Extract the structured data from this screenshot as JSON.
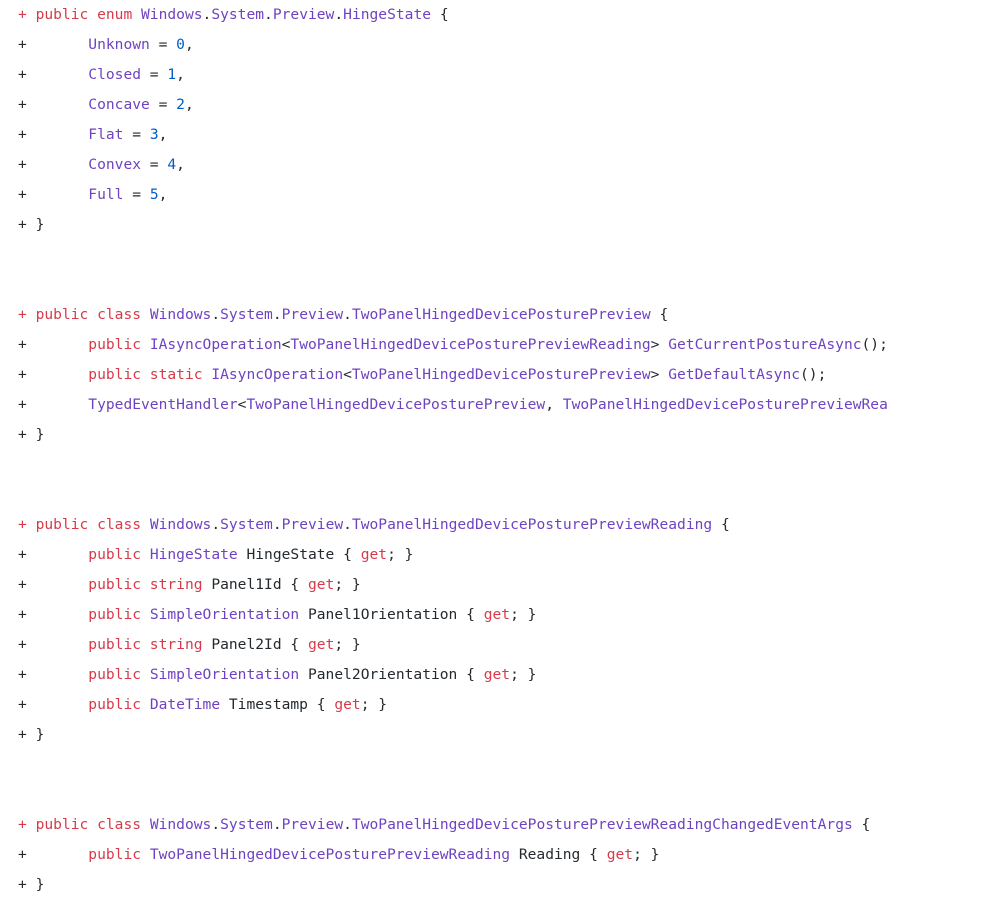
{
  "document": {
    "kind": "api-diff",
    "language": "csharp",
    "colors": {
      "background": "#ffffff",
      "keyword": "#d73a49",
      "type": "#6f42c1",
      "number": "#005cc5",
      "plain": "#24292e"
    }
  },
  "lines": [
    {
      "id": "line-1",
      "type": "addition",
      "tokens": [
        {
          "t": "+ ",
          "c": "kw"
        },
        {
          "t": "public enum ",
          "c": "kw"
        },
        {
          "t": "Windows",
          "c": "type"
        },
        {
          "t": ".",
          "c": "plain"
        },
        {
          "t": "System",
          "c": "type"
        },
        {
          "t": ".",
          "c": "plain"
        },
        {
          "t": "Preview",
          "c": "type"
        },
        {
          "t": ".",
          "c": "plain"
        },
        {
          "t": "HingeState",
          "c": "type"
        },
        {
          "t": " {",
          "c": "plain"
        }
      ]
    },
    {
      "id": "line-2",
      "type": "addition",
      "tokens": [
        {
          "t": "+ ",
          "c": "marker"
        },
        {
          "t": "      ",
          "c": "plain"
        },
        {
          "t": "Unknown",
          "c": "type"
        },
        {
          "t": " = ",
          "c": "plain"
        },
        {
          "t": "0",
          "c": "num"
        },
        {
          "t": ",",
          "c": "plain"
        }
      ]
    },
    {
      "id": "line-3",
      "type": "addition",
      "tokens": [
        {
          "t": "+ ",
          "c": "marker"
        },
        {
          "t": "      ",
          "c": "plain"
        },
        {
          "t": "Closed",
          "c": "type"
        },
        {
          "t": " = ",
          "c": "plain"
        },
        {
          "t": "1",
          "c": "num"
        },
        {
          "t": ",",
          "c": "plain"
        }
      ]
    },
    {
      "id": "line-4",
      "type": "addition",
      "tokens": [
        {
          "t": "+ ",
          "c": "marker"
        },
        {
          "t": "      ",
          "c": "plain"
        },
        {
          "t": "Concave",
          "c": "type"
        },
        {
          "t": " = ",
          "c": "plain"
        },
        {
          "t": "2",
          "c": "num"
        },
        {
          "t": ",",
          "c": "plain"
        }
      ]
    },
    {
      "id": "line-5",
      "type": "addition",
      "tokens": [
        {
          "t": "+ ",
          "c": "marker"
        },
        {
          "t": "      ",
          "c": "plain"
        },
        {
          "t": "Flat",
          "c": "type"
        },
        {
          "t": " = ",
          "c": "plain"
        },
        {
          "t": "3",
          "c": "num"
        },
        {
          "t": ",",
          "c": "plain"
        }
      ]
    },
    {
      "id": "line-6",
      "type": "addition",
      "tokens": [
        {
          "t": "+ ",
          "c": "marker"
        },
        {
          "t": "      ",
          "c": "plain"
        },
        {
          "t": "Convex",
          "c": "type"
        },
        {
          "t": " = ",
          "c": "plain"
        },
        {
          "t": "4",
          "c": "num"
        },
        {
          "t": ",",
          "c": "plain"
        }
      ]
    },
    {
      "id": "line-7",
      "type": "addition",
      "tokens": [
        {
          "t": "+ ",
          "c": "marker"
        },
        {
          "t": "      ",
          "c": "plain"
        },
        {
          "t": "Full",
          "c": "type"
        },
        {
          "t": " = ",
          "c": "plain"
        },
        {
          "t": "5",
          "c": "num"
        },
        {
          "t": ",",
          "c": "plain"
        }
      ]
    },
    {
      "id": "line-8",
      "type": "addition",
      "tokens": [
        {
          "t": "+ ",
          "c": "marker"
        },
        {
          "t": "}",
          "c": "plain"
        }
      ]
    },
    {
      "id": "line-9",
      "type": "blank",
      "tokens": []
    },
    {
      "id": "line-10",
      "type": "blank",
      "tokens": []
    },
    {
      "id": "line-11",
      "type": "addition",
      "tokens": [
        {
          "t": "+ ",
          "c": "kw"
        },
        {
          "t": "public class ",
          "c": "kw"
        },
        {
          "t": "Windows",
          "c": "type"
        },
        {
          "t": ".",
          "c": "plain"
        },
        {
          "t": "System",
          "c": "type"
        },
        {
          "t": ".",
          "c": "plain"
        },
        {
          "t": "Preview",
          "c": "type"
        },
        {
          "t": ".",
          "c": "plain"
        },
        {
          "t": "TwoPanelHingedDevicePosturePreview",
          "c": "type"
        },
        {
          "t": " {",
          "c": "plain"
        }
      ]
    },
    {
      "id": "line-12",
      "type": "addition",
      "tokens": [
        {
          "t": "+ ",
          "c": "marker"
        },
        {
          "t": "      ",
          "c": "plain"
        },
        {
          "t": "public ",
          "c": "kw"
        },
        {
          "t": "IAsyncOperation",
          "c": "type"
        },
        {
          "t": "<",
          "c": "plain"
        },
        {
          "t": "TwoPanelHingedDevicePosturePreviewReading",
          "c": "type"
        },
        {
          "t": "> ",
          "c": "plain"
        },
        {
          "t": "GetCurrentPostureAsync",
          "c": "type"
        },
        {
          "t": "();",
          "c": "plain"
        }
      ]
    },
    {
      "id": "line-13",
      "type": "addition",
      "tokens": [
        {
          "t": "+ ",
          "c": "marker"
        },
        {
          "t": "      ",
          "c": "plain"
        },
        {
          "t": "public static ",
          "c": "kw"
        },
        {
          "t": "IAsyncOperation",
          "c": "type"
        },
        {
          "t": "<",
          "c": "plain"
        },
        {
          "t": "TwoPanelHingedDevicePosturePreview",
          "c": "type"
        },
        {
          "t": "> ",
          "c": "plain"
        },
        {
          "t": "GetDefaultAsync",
          "c": "type"
        },
        {
          "t": "();",
          "c": "plain"
        }
      ]
    },
    {
      "id": "line-14",
      "type": "addition",
      "tokens": [
        {
          "t": "+ ",
          "c": "marker"
        },
        {
          "t": "      ",
          "c": "plain"
        },
        {
          "t": "TypedEventHandler",
          "c": "type"
        },
        {
          "t": "<",
          "c": "plain"
        },
        {
          "t": "TwoPanelHingedDevicePosturePreview",
          "c": "type"
        },
        {
          "t": ", ",
          "c": "plain"
        },
        {
          "t": "TwoPanelHingedDevicePosturePreviewRea",
          "c": "type"
        }
      ]
    },
    {
      "id": "line-15",
      "type": "addition",
      "tokens": [
        {
          "t": "+ ",
          "c": "marker"
        },
        {
          "t": "}",
          "c": "plain"
        }
      ]
    },
    {
      "id": "line-16",
      "type": "blank",
      "tokens": []
    },
    {
      "id": "line-17",
      "type": "blank",
      "tokens": []
    },
    {
      "id": "line-18",
      "type": "addition",
      "tokens": [
        {
          "t": "+ ",
          "c": "kw"
        },
        {
          "t": "public class ",
          "c": "kw"
        },
        {
          "t": "Windows",
          "c": "type"
        },
        {
          "t": ".",
          "c": "plain"
        },
        {
          "t": "System",
          "c": "type"
        },
        {
          "t": ".",
          "c": "plain"
        },
        {
          "t": "Preview",
          "c": "type"
        },
        {
          "t": ".",
          "c": "plain"
        },
        {
          "t": "TwoPanelHingedDevicePosturePreviewReading",
          "c": "type"
        },
        {
          "t": " {",
          "c": "plain"
        }
      ]
    },
    {
      "id": "line-19",
      "type": "addition",
      "tokens": [
        {
          "t": "+ ",
          "c": "marker"
        },
        {
          "t": "      ",
          "c": "plain"
        },
        {
          "t": "public ",
          "c": "kw"
        },
        {
          "t": "HingeState",
          "c": "type"
        },
        {
          "t": " HingeState { ",
          "c": "plain"
        },
        {
          "t": "get",
          "c": "kw"
        },
        {
          "t": "; }",
          "c": "plain"
        }
      ]
    },
    {
      "id": "line-20",
      "type": "addition",
      "tokens": [
        {
          "t": "+ ",
          "c": "marker"
        },
        {
          "t": "      ",
          "c": "plain"
        },
        {
          "t": "public string",
          "c": "kw"
        },
        {
          "t": " Panel1Id { ",
          "c": "plain"
        },
        {
          "t": "get",
          "c": "kw"
        },
        {
          "t": "; }",
          "c": "plain"
        }
      ]
    },
    {
      "id": "line-21",
      "type": "addition",
      "tokens": [
        {
          "t": "+ ",
          "c": "marker"
        },
        {
          "t": "      ",
          "c": "plain"
        },
        {
          "t": "public ",
          "c": "kw"
        },
        {
          "t": "SimpleOrientation",
          "c": "type"
        },
        {
          "t": " Panel1Orientation { ",
          "c": "plain"
        },
        {
          "t": "get",
          "c": "kw"
        },
        {
          "t": "; }",
          "c": "plain"
        }
      ]
    },
    {
      "id": "line-22",
      "type": "addition",
      "tokens": [
        {
          "t": "+ ",
          "c": "marker"
        },
        {
          "t": "      ",
          "c": "plain"
        },
        {
          "t": "public string",
          "c": "kw"
        },
        {
          "t": " Panel2Id { ",
          "c": "plain"
        },
        {
          "t": "get",
          "c": "kw"
        },
        {
          "t": "; }",
          "c": "plain"
        }
      ]
    },
    {
      "id": "line-23",
      "type": "addition",
      "tokens": [
        {
          "t": "+ ",
          "c": "marker"
        },
        {
          "t": "      ",
          "c": "plain"
        },
        {
          "t": "public ",
          "c": "kw"
        },
        {
          "t": "SimpleOrientation",
          "c": "type"
        },
        {
          "t": " Panel2Orientation { ",
          "c": "plain"
        },
        {
          "t": "get",
          "c": "kw"
        },
        {
          "t": "; }",
          "c": "plain"
        }
      ]
    },
    {
      "id": "line-24",
      "type": "addition",
      "tokens": [
        {
          "t": "+ ",
          "c": "marker"
        },
        {
          "t": "      ",
          "c": "plain"
        },
        {
          "t": "public ",
          "c": "kw"
        },
        {
          "t": "DateTime",
          "c": "type"
        },
        {
          "t": " Timestamp { ",
          "c": "plain"
        },
        {
          "t": "get",
          "c": "kw"
        },
        {
          "t": "; }",
          "c": "plain"
        }
      ]
    },
    {
      "id": "line-25",
      "type": "addition",
      "tokens": [
        {
          "t": "+ ",
          "c": "marker"
        },
        {
          "t": "}",
          "c": "plain"
        }
      ]
    },
    {
      "id": "line-26",
      "type": "blank",
      "tokens": []
    },
    {
      "id": "line-27",
      "type": "blank",
      "tokens": []
    },
    {
      "id": "line-28",
      "type": "addition",
      "tokens": [
        {
          "t": "+ ",
          "c": "kw"
        },
        {
          "t": "public class ",
          "c": "kw"
        },
        {
          "t": "Windows",
          "c": "type"
        },
        {
          "t": ".",
          "c": "plain"
        },
        {
          "t": "System",
          "c": "type"
        },
        {
          "t": ".",
          "c": "plain"
        },
        {
          "t": "Preview",
          "c": "type"
        },
        {
          "t": ".",
          "c": "plain"
        },
        {
          "t": "TwoPanelHingedDevicePosturePreviewReadingChangedEventArgs",
          "c": "type"
        },
        {
          "t": " {",
          "c": "plain"
        }
      ]
    },
    {
      "id": "line-29",
      "type": "addition",
      "tokens": [
        {
          "t": "+ ",
          "c": "marker"
        },
        {
          "t": "      ",
          "c": "plain"
        },
        {
          "t": "public ",
          "c": "kw"
        },
        {
          "t": "TwoPanelHingedDevicePosturePreviewReading",
          "c": "type"
        },
        {
          "t": " Reading { ",
          "c": "plain"
        },
        {
          "t": "get",
          "c": "kw"
        },
        {
          "t": "; }",
          "c": "plain"
        }
      ]
    },
    {
      "id": "line-30",
      "type": "addition",
      "tokens": [
        {
          "t": "+ ",
          "c": "marker"
        },
        {
          "t": "}",
          "c": "plain"
        }
      ]
    }
  ]
}
